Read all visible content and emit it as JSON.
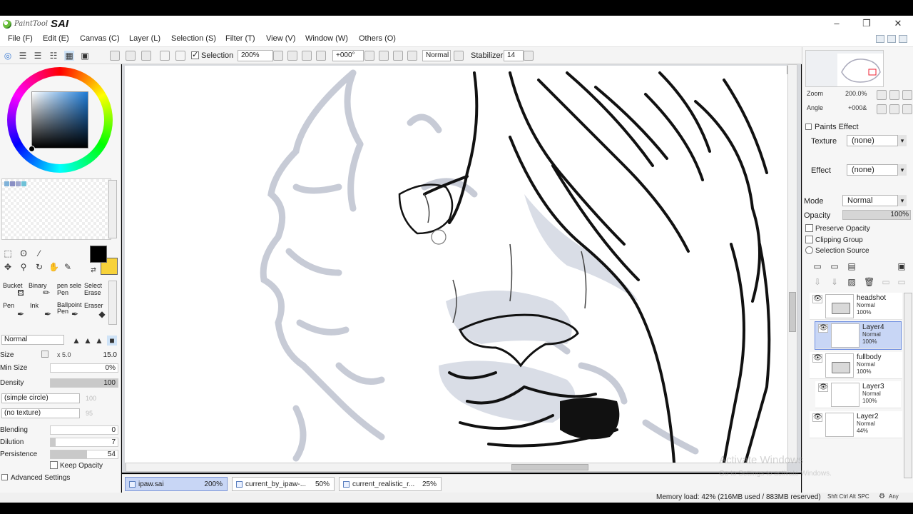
{
  "app": {
    "logo_small": "PaintTool",
    "logo_big": "SAI"
  },
  "menu": [
    {
      "label": "File (F)"
    },
    {
      "label": "Edit (E)"
    },
    {
      "label": "Canvas (C)"
    },
    {
      "label": "Layer (L)"
    },
    {
      "label": "Selection (S)"
    },
    {
      "label": "Filter (T)"
    },
    {
      "label": "View (V)"
    },
    {
      "label": "Window (W)"
    },
    {
      "label": "Others (O)"
    }
  ],
  "toolbar": {
    "selection_label": "Selection",
    "selection_checked": true,
    "zoom": "200%",
    "rotation": "+000°",
    "blend_mode": "Normal",
    "stabilizer_label": "Stabilizer",
    "stabilizer_value": "14"
  },
  "tools": [
    {
      "label": "Bucket"
    },
    {
      "label": "Binary"
    },
    {
      "label": "pen sele"
    },
    {
      "label": "Select"
    },
    {
      "label": "Pen"
    },
    {
      "label": "Ink"
    },
    {
      "label": "Ballpoint Pen"
    },
    {
      "label": "Eraser"
    }
  ],
  "tool_sublabels": [
    "Pen",
    "Erase",
    "Pen"
  ],
  "tool_props": {
    "mode": "Normal",
    "size_label": "Size",
    "size_multiplier": "x 5.0",
    "size_value": "15.0",
    "min_size_label": "Min Size",
    "min_size_value": "0%",
    "density_label": "Density",
    "density_value": "100",
    "shape": "(simple circle)",
    "shape_value": "100",
    "texture": "(no texture)",
    "texture_value": "95",
    "blending_label": "Blending",
    "blending_value": "0",
    "dilution_label": "Dilution",
    "dilution_value": "7",
    "persistence_label": "Persistence",
    "persistence_value": "54",
    "keep_opacity_label": "Keep Opacity",
    "advanced_label": "Advanced Settings"
  },
  "navigator": {
    "zoom_label": "Zoom",
    "zoom_value": "200.0%",
    "angle_label": "Angle",
    "angle_value": "+000&"
  },
  "paints_effect": {
    "header": "Paints Effect",
    "texture_label": "Texture",
    "texture_value": "(none)",
    "effect_label": "Effect",
    "effect_value": "(none)"
  },
  "layer_props": {
    "mode_label": "Mode",
    "mode_value": "Normal",
    "opacity_label": "Opacity",
    "opacity_value": "100%",
    "preserve_opacity": "Preserve Opacity",
    "clipping_group": "Clipping Group",
    "selection_source": "Selection Source"
  },
  "layers": [
    {
      "name": "headshot",
      "mode": "Normal",
      "opacity": "100%",
      "folder": true,
      "selected": false
    },
    {
      "name": "Layer4",
      "mode": "Normal",
      "opacity": "100%",
      "folder": false,
      "selected": true
    },
    {
      "name": "fullbody",
      "mode": "Normal",
      "opacity": "100%",
      "folder": true,
      "selected": false
    },
    {
      "name": "Layer3",
      "mode": "Normal",
      "opacity": "100%",
      "folder": false,
      "selected": false
    },
    {
      "name": "Layer2",
      "mode": "Normal",
      "opacity": "44%",
      "folder": false,
      "selected": false
    }
  ],
  "documents": [
    {
      "name": "ipaw.sai",
      "zoom": "200%",
      "active": true
    },
    {
      "name": "current_by_ipaw-...",
      "zoom": "50%",
      "active": false
    },
    {
      "name": "current_realistic_r...",
      "zoom": "25%",
      "active": false
    }
  ],
  "status": {
    "memory": "Memory load: 42% (216MB used / 883MB reserved)",
    "keys": "Shft Ctrl Alt SPC",
    "any": "Any"
  },
  "watermark": {
    "title": "Activate Windows",
    "sub": "Go to Settings to activate Windows."
  },
  "colors": {
    "foreground": "#000000",
    "background": "#f7d23a",
    "selected_layer": "#c8d6f5"
  }
}
